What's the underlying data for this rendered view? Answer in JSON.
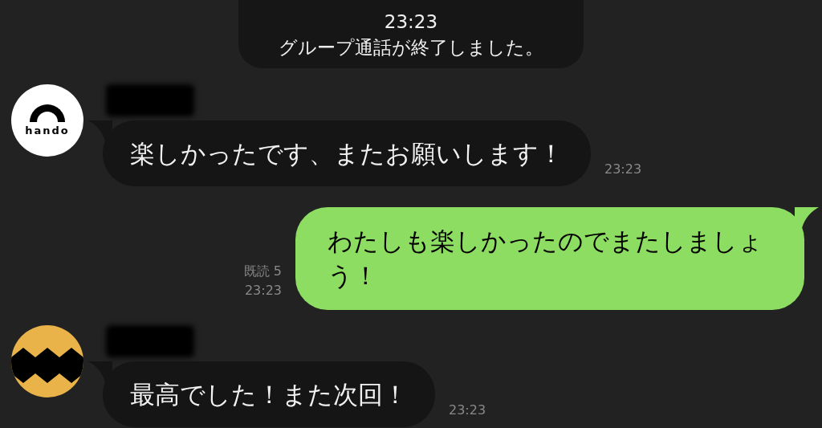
{
  "system_message": {
    "time": "23:23",
    "text": "グループ通話が終了しました。"
  },
  "messages": [
    {
      "kind": "incoming",
      "avatar": {
        "kind": "logo",
        "text": "hando"
      },
      "text": "楽しかったです、またお願いします！",
      "time": "23:23"
    },
    {
      "kind": "outgoing",
      "text": "わたしも楽しかったのでまたしましょう！",
      "read_receipt": "既読 5",
      "time": "23:23"
    },
    {
      "kind": "incoming",
      "avatar": {
        "kind": "zigzag"
      },
      "text": "最高でした！また次回！",
      "time": "23:23"
    }
  ]
}
